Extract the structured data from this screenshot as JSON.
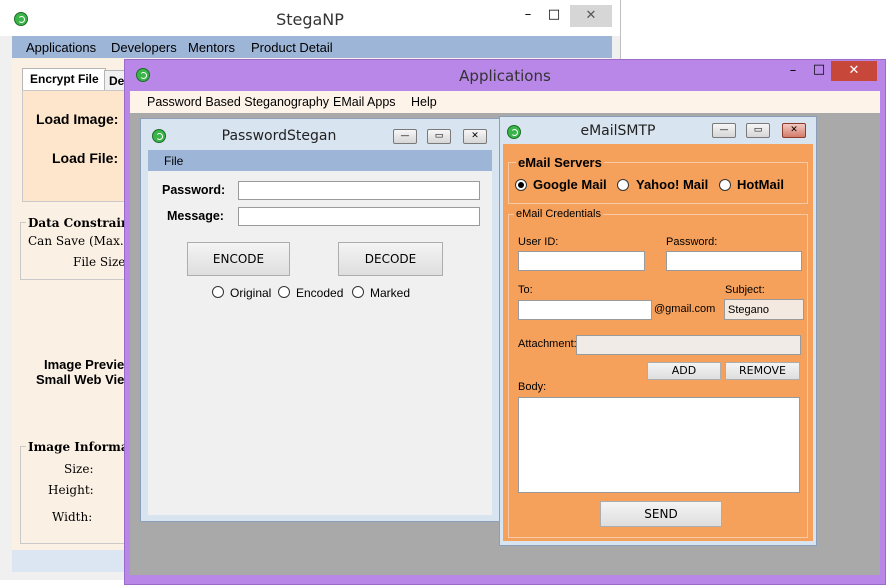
{
  "stegaNP": {
    "title": "StegaNP",
    "menu": [
      "Applications",
      "Developers",
      "Mentors",
      "Product Detail"
    ],
    "tabs": [
      "Encrypt File",
      "De"
    ],
    "load_image_label": "Load Image:",
    "load_file_label": "Load File:",
    "data_constraint": {
      "title": "Data Constraint",
      "can_save_label": "Can Save (Max.):",
      "file_size_label": "File Size:"
    },
    "image_preview_line1": "Image Previe",
    "image_preview_line2": "Small Web Vie",
    "image_info": {
      "title": "Image Informatio",
      "size_label": "Size:",
      "height_label": "Height:",
      "width_label": "Width:"
    }
  },
  "applications": {
    "title": "Applications",
    "menu": [
      "Password Based Steganography",
      "EMail Apps",
      "Help"
    ]
  },
  "passwordStegan": {
    "title": "PasswordStegan",
    "menu_file": "File",
    "password_label": "Password:",
    "message_label": "Message:",
    "password_value": "",
    "message_value": "",
    "encode_label": "ENCODE",
    "decode_label": "DECODE",
    "radios": [
      {
        "label": "Original",
        "checked": false
      },
      {
        "label": "Encoded",
        "checked": false
      },
      {
        "label": "Marked",
        "checked": false
      }
    ]
  },
  "emailSMTP": {
    "title": "eMailSMTP",
    "servers_title": "eMail Servers",
    "servers": [
      {
        "label": "Google Mail",
        "checked": true
      },
      {
        "label": "Yahoo! Mail",
        "checked": false
      },
      {
        "label": "HotMail",
        "checked": false
      }
    ],
    "credentials_title": "eMail Credentials",
    "user_id_label": "User ID:",
    "password_label": "Password:",
    "to_label": "To:",
    "to_suffix": "@gmail.com",
    "subject_label": "Subject:",
    "subject_value": "Stegano",
    "attachment_label": "Attachment:",
    "add_label": "ADD",
    "remove_label": "REMOVE",
    "body_label": "Body:",
    "send_label": "SEND"
  },
  "colors": {
    "purple_frame": "#b987e8",
    "orange_panel": "#f5a05b",
    "menu_blue": "#9db5d6",
    "peach": "#fde6cc"
  }
}
